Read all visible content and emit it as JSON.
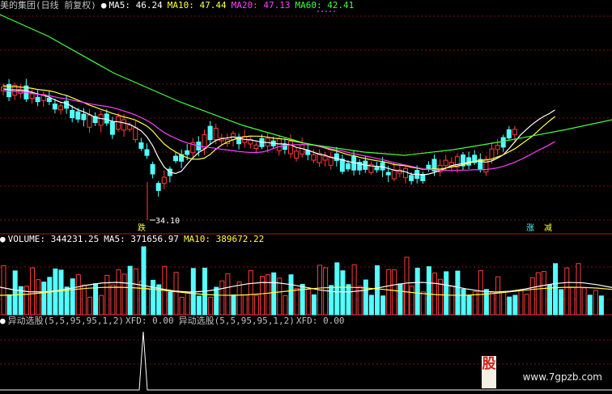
{
  "price_panel": {
    "title": "美的集团(日线 前复权)",
    "ma5": "MA5: 46.24",
    "ma10": "MA10: 47.44",
    "ma20": "MA20: 47.13",
    "ma60": "MA60: 42.41",
    "low_label": "←34.10",
    "signal_die": "跌",
    "signal_zhang": "涨",
    "signal_jian": "减",
    "colors": {
      "up": "#ff3b3b",
      "down": "#54ffff",
      "ma5": "#ffffff",
      "ma10": "#ffff40",
      "ma20": "#ff40ff",
      "ma60": "#40ff40",
      "grid": "#801010"
    }
  },
  "volume_panel": {
    "volume": "VOLUME: 344231.25",
    "ma5": "MA5: 371656.97",
    "ma10": "MA10: 389672.22"
  },
  "indicator_panel": {
    "name": "异动选股(5,5,95,95,1,2)",
    "xfd": "XFD: 0.00",
    "name2": "异动选股(5,5,95,95,1,2)",
    "xfd2": "XFD: 0.00"
  },
  "watermark": "www.7gpzb.com",
  "logo_text": "股"
}
